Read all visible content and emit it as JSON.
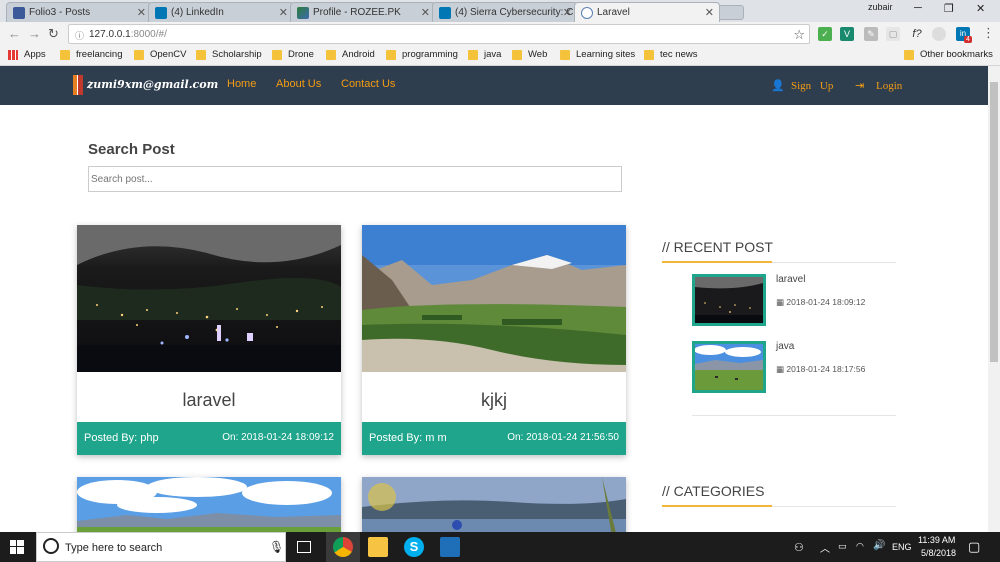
{
  "browser": {
    "tabs": [
      {
        "title": "Folio3 - Posts",
        "favicon": "facebook-icon",
        "active": false
      },
      {
        "title": "(4) LinkedIn",
        "favicon": "linkedin-icon",
        "active": false
      },
      {
        "title": "Profile - ROZEE.PK",
        "favicon": "rozee-icon",
        "active": false
      },
      {
        "title": "(4) Sierra Cybersecurity: C",
        "favicon": "linkedin-icon",
        "active": false
      },
      {
        "title": "Laravel",
        "favicon": "laravel-icon",
        "active": true
      }
    ],
    "profile_name": "zubair",
    "address": {
      "prefix": "127.0.0.1",
      "rest": ":8000/#/"
    },
    "bookmarks": [
      "Apps",
      "freelancing",
      "OpenCV",
      "Scholarship",
      "Drone",
      "Android",
      "programming",
      "java",
      "Web",
      "Learning sites",
      "tec news"
    ],
    "other_bookmarks": "Other bookmarks",
    "ext_badge": "4"
  },
  "site": {
    "logo": "zumi9xm@gmail.com",
    "nav": [
      "Home",
      "About Us",
      "Contact Us"
    ],
    "signup": "Sign Up",
    "login": "Login"
  },
  "search": {
    "title": "Search Post",
    "placeholder": "Search post..."
  },
  "posts": [
    {
      "title": "laravel",
      "posted_by": "Posted By: php",
      "on": "On: 2018-01-24 18:09:12"
    },
    {
      "title": "kjkj",
      "posted_by": "Posted By: m m",
      "on": "On: 2018-01-24 21:56:50"
    }
  ],
  "sidebar": {
    "recent_title": "// RECENT POST",
    "recent": [
      {
        "title": "laravel",
        "date": "2018-01-24 18:09:12"
      },
      {
        "title": "java",
        "date": "2018-01-24 18:17:56"
      }
    ],
    "categories_title": "// CATEGORIES"
  },
  "taskbar": {
    "search_placeholder": "Type here to search",
    "lang": "ENG",
    "time": "11:39 AM",
    "date": "5/8/2018"
  },
  "colors": {
    "navbar": "#2f3e4e",
    "accent": "#f39c12",
    "teal": "#1fa58b"
  }
}
